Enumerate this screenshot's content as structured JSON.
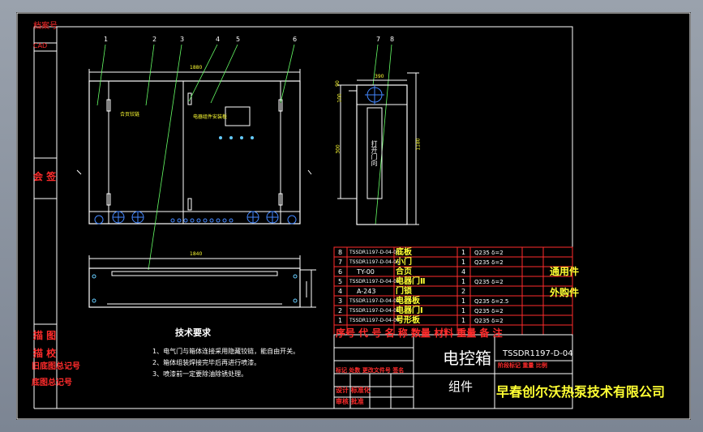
{
  "frame": {
    "archive_label": "档案号",
    "cad_label": "CAD",
    "sign_label": "会  签",
    "left_bottom": [
      "描  图",
      "描  校",
      "旧底图总记号",
      "底图总记号"
    ]
  },
  "callouts": [
    "1",
    "2",
    "3",
    "4",
    "5",
    "6",
    "7",
    "8"
  ],
  "dims": {
    "front_width": "1880",
    "bottom_width": "1840",
    "side_width": "390",
    "side_height": "1180",
    "d_small1": "90",
    "d_small2": "300",
    "d_small3": "100"
  },
  "front_labels": {
    "left_label": "合页铰链",
    "center_label": "电器组件安装板"
  },
  "side_label": "打开门向",
  "notes": {
    "title": "技术要求",
    "items": [
      "1、电气门与箱体连接采用隐藏铰链，能自由开关。",
      "2、箱体组装焊接完毕后再进行喷漆。",
      "3、喷漆前一定要除油除锈处理。"
    ]
  },
  "bom": {
    "rows": [
      {
        "no": "8",
        "code": "TSSDR1197-D-04-05",
        "name": "底板",
        "qty": "1",
        "material": "Q235 δ=2"
      },
      {
        "no": "7",
        "code": "TSSDR1197-D-04-05",
        "name": "小门",
        "qty": "1",
        "material": "Q235 δ=2"
      },
      {
        "no": "6",
        "code": "TY-00",
        "name": "合页",
        "qty": "4",
        "material": ""
      },
      {
        "no": "5",
        "code": "TSSDR1197-D-04-03",
        "name": "电器门Ⅱ",
        "qty": "1",
        "material": "Q235 δ=2"
      },
      {
        "no": "4",
        "code": "A-243",
        "name": "门锁",
        "qty": "2",
        "material": ""
      },
      {
        "no": "3",
        "code": "TSSDR1197-D-04-02",
        "name": "电器板",
        "qty": "1",
        "material": "Q235 δ=2.5"
      },
      {
        "no": "2",
        "code": "TSSDR1197-D-04-01",
        "name": "电器门Ⅰ",
        "qty": "1",
        "material": "Q235 δ=2"
      },
      {
        "no": "1",
        "code": "TSSDR1197-D-04-00",
        "name": "号形板",
        "qty": "1",
        "material": "Q235 δ=2"
      }
    ],
    "side_notes": [
      "通用件",
      "外购件"
    ],
    "header": "序号 代  号  名  称 数量 材料 重量 备 注"
  },
  "title_block": {
    "name": "电控箱",
    "drawing_no": "TSSDR1197-D-04",
    "kind": "组件",
    "company": "早春创尔沃热泵技术有限公司",
    "mark_line": "标记 处数 更改文件号 签名",
    "design_row": "设计  标准化",
    "review_row": "审核  批准",
    "stage_row": "阶段标记 重量 比例"
  }
}
